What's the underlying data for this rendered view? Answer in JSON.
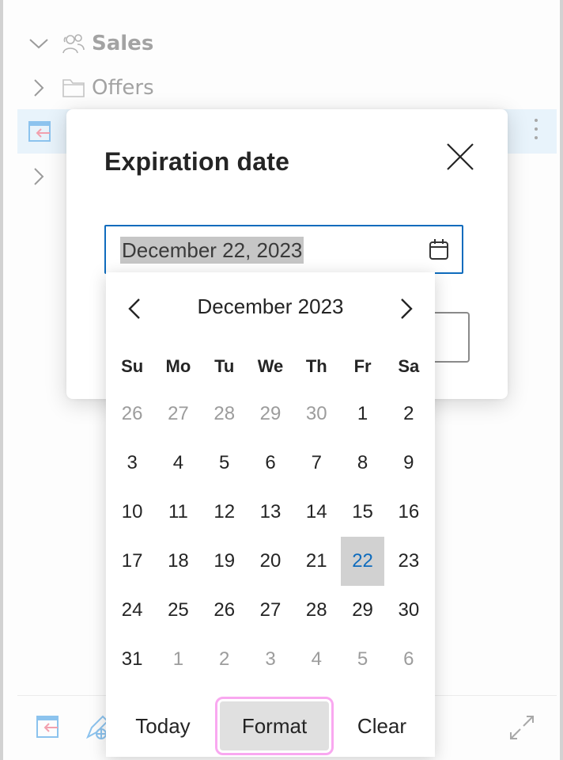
{
  "tree": {
    "items": [
      {
        "label": "Sales",
        "icon": "people-icon",
        "expanded": true
      },
      {
        "label": "Offers",
        "icon": "folder-icon",
        "expanded": false
      },
      {
        "label": "",
        "icon": "calendar-arrow-icon",
        "selected": true
      },
      {
        "label": "",
        "icon": "folder-icon",
        "expanded": false
      }
    ]
  },
  "dialog": {
    "title": "Expiration date",
    "date_value": "December 22, 2023"
  },
  "picker": {
    "month_label": "December 2023",
    "weekdays": [
      "Su",
      "Mo",
      "Tu",
      "We",
      "Th",
      "Fr",
      "Sa"
    ],
    "days": [
      {
        "d": "26",
        "other": true
      },
      {
        "d": "27",
        "other": true
      },
      {
        "d": "28",
        "other": true
      },
      {
        "d": "29",
        "other": true
      },
      {
        "d": "30",
        "other": true
      },
      {
        "d": "1"
      },
      {
        "d": "2"
      },
      {
        "d": "3"
      },
      {
        "d": "4"
      },
      {
        "d": "5"
      },
      {
        "d": "6"
      },
      {
        "d": "7"
      },
      {
        "d": "8"
      },
      {
        "d": "9"
      },
      {
        "d": "10"
      },
      {
        "d": "11"
      },
      {
        "d": "12"
      },
      {
        "d": "13"
      },
      {
        "d": "14"
      },
      {
        "d": "15"
      },
      {
        "d": "16"
      },
      {
        "d": "17"
      },
      {
        "d": "18"
      },
      {
        "d": "19"
      },
      {
        "d": "20"
      },
      {
        "d": "21"
      },
      {
        "d": "22",
        "selected": true
      },
      {
        "d": "23"
      },
      {
        "d": "24"
      },
      {
        "d": "25"
      },
      {
        "d": "26"
      },
      {
        "d": "27"
      },
      {
        "d": "28"
      },
      {
        "d": "29"
      },
      {
        "d": "30"
      },
      {
        "d": "31"
      },
      {
        "d": "1",
        "other": true
      },
      {
        "d": "2",
        "other": true
      },
      {
        "d": "3",
        "other": true
      },
      {
        "d": "4",
        "other": true
      },
      {
        "d": "5",
        "other": true
      },
      {
        "d": "6",
        "other": true
      }
    ],
    "buttons": {
      "today": "Today",
      "format": "Format",
      "clear": "Clear"
    }
  },
  "colors": {
    "accent": "#0f6cbd",
    "selected_bg": "#d1d1d1",
    "highlight_outline": "#f9a8f0"
  }
}
